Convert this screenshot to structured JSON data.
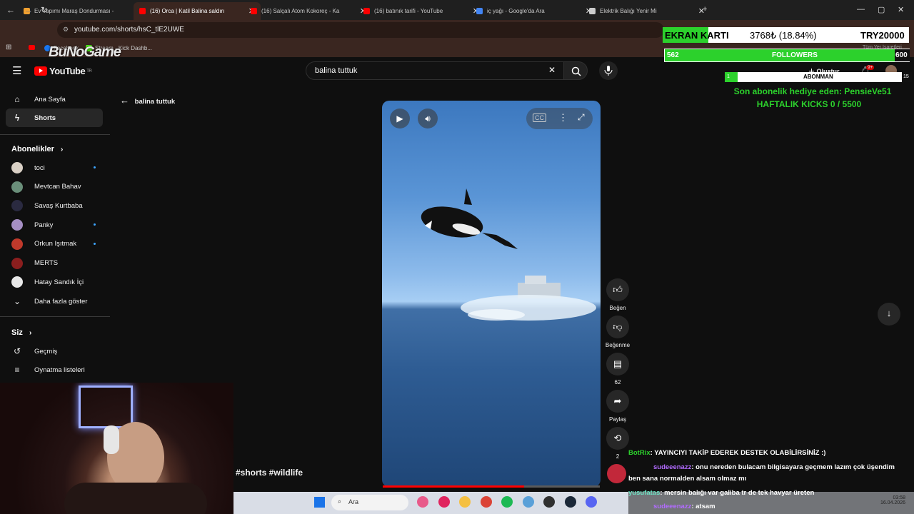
{
  "browser": {
    "tabs": [
      {
        "title": "Ev Yapımı Maraş Dondurması - ",
        "favicon": "#f0a030",
        "active": false
      },
      {
        "title": "(16) Orca | Katil Balina saldırı",
        "favicon": "#ff0000",
        "active": true
      },
      {
        "title": "(16) Salçalı Atom Kokoreç - Ka",
        "favicon": "#ff0000",
        "active": false
      },
      {
        "title": "(16) batınık tarifi - YouTube",
        "favicon": "#ff0000",
        "active": false
      },
      {
        "title": "iç yağı - Google'da Ara",
        "favicon": "#4285f4",
        "active": false
      },
      {
        "title": "Elektrik Balığı Yenir Mi",
        "favicon": "#cccccc",
        "active": false
      }
    ],
    "url": "youtube.com/shorts/hsC_tlE2UWE",
    "bookmarks": [
      "Facebook",
      "Stream - Kick Dashb..."
    ],
    "bookmarks_right": "Tüm Yer İşaretleri"
  },
  "youtube": {
    "logo_text": "YouTube",
    "logo_region": "TR",
    "search_value": "balina tuttuk",
    "back_label": "balina tuttuk",
    "create_label": "Oluştur",
    "notif_count": "9+",
    "sidebar": {
      "main": [
        {
          "label": "Ana Sayfa",
          "icon": "home-icon"
        },
        {
          "label": "Shorts",
          "icon": "shorts-icon"
        }
      ],
      "subs_title": "Abonelikler",
      "subs": [
        {
          "label": "toci",
          "color": "#d9d0c5",
          "dot": true
        },
        {
          "label": "Mevtcan Bahav",
          "color": "#6a8f7a",
          "dot": false
        },
        {
          "label": "Savaş Kurtbaba",
          "color": "#2a2a40",
          "dot": false
        },
        {
          "label": "Panky",
          "color": "#a68fc4",
          "dot": true
        },
        {
          "label": "Orkun Işıtmak",
          "color": "#c0392b",
          "dot": true
        },
        {
          "label": "MERTS",
          "color": "#8b1e1e",
          "dot": false
        },
        {
          "label": "Hatay Sandık İçi",
          "color": "#e8e8e8",
          "dot": false
        }
      ],
      "more_label": "Daha fazla göster",
      "you_title": "Siz",
      "you": [
        {
          "label": "Geçmiş",
          "icon": "history-icon"
        },
        {
          "label": "Oynatma listeleri",
          "icon": "playlists-icon"
        }
      ]
    },
    "actions": {
      "like": "Beğen",
      "dislike": "Beğenme",
      "comments": "62",
      "share": "Paylaş",
      "remix": "2"
    },
    "hashtags": "#shorts #wildlife",
    "progress_percent": 65
  },
  "overlay": {
    "watermark": "BuNoGame",
    "ekran_label": "EKRAN KARTI",
    "ekran_value": "3768₺ (18.84%)",
    "ekran_goal": "TRY20000",
    "followers_current": "562",
    "followers_label": "FOLLOWERS",
    "followers_goal": "600",
    "abonman_current": "1",
    "abonman_label": "ABONMAN",
    "abonman_goal": "15",
    "gift_text": "Son abonelik hediye eden: PensieVe51",
    "kicks_text": "HAFTALIK KICKS 0 / 5500",
    "chat": [
      {
        "user": "BotRix",
        "text": ": YAYINCIYI TAKİP EDEREK DESTEK OLABİLİRSİNİZ :)"
      },
      {
        "user": "sudeeenazz",
        "text": ": onu nereden bulacam bilgisayara geçmem lazım çok üşendim"
      },
      {
        "user": "",
        "text": "ben sana normalden alsam olmaz mı"
      },
      {
        "user": "yusufatas",
        "text": ": mersin balığı var galiba tr de tek havyar üreten"
      },
      {
        "user": "sudeeenazz",
        "text": ": atsam"
      }
    ]
  },
  "taskbar": {
    "search_placeholder": "Ara",
    "time": "03:58",
    "date": "16.04.2026"
  }
}
